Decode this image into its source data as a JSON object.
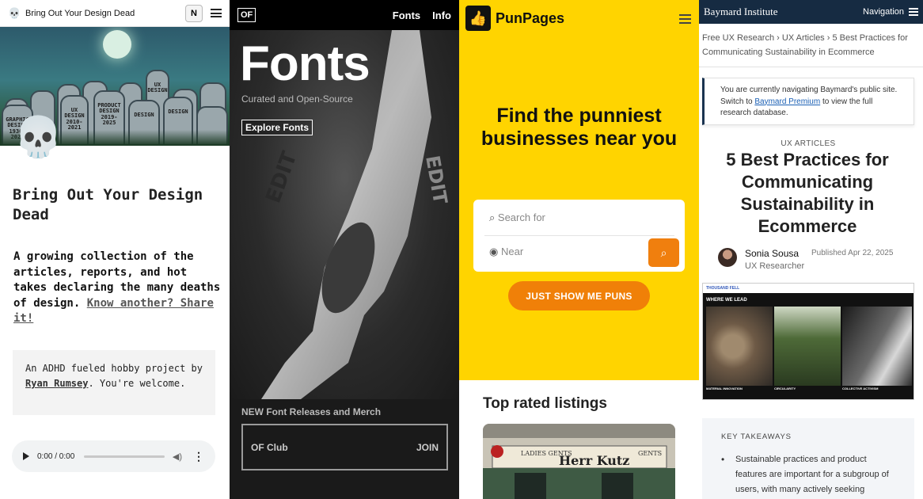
{
  "panel1": {
    "tab_title": "Bring Out Your Design Dead",
    "favicon": "💀",
    "notion_icon": "N",
    "hero_tombstones": [
      "UX DESIGN",
      "GRAPHIC DESIGN 1930-2021",
      "UX DESIGN 2010-2021",
      "PRODUCT DESIGN 2019-2025",
      "DESIGN",
      "DESIGN"
    ],
    "skull": "💀",
    "heading": "Bring Out Your Design Dead",
    "lede": "A growing collection of the articles, reports, and hot takes declaring the many deaths of design.",
    "lede_link": "Know another? Share it!",
    "note_prefix": "An ADHD fueled hobby project by ",
    "note_author": "Ryan Rumsey",
    "note_suffix": ". You're welcome.",
    "audio_time": "0:00 / 0:00"
  },
  "panel2": {
    "logo": "OF",
    "nav": [
      "Fonts",
      "Info"
    ],
    "hero_title": "Fonts",
    "hero_subtitle": "Curated and Open-Source",
    "hero_button": "Explore Fonts",
    "hero_edit_text": [
      "EDIT",
      "EDIT"
    ],
    "release_label": "NEW Font Releases and Merch",
    "club_label": "OF Club",
    "club_join": "JOIN"
  },
  "panel3": {
    "brand": "PunPages",
    "headline": "Find the punniest businesses near you",
    "search_placeholder": "Search for",
    "near_placeholder": "Near",
    "cta": "JUST SHOW ME PUNS",
    "section_title": "Top rated listings",
    "listing_sign_left": "LADIES GENTS",
    "listing_sign": "Herr Kutz",
    "listing_sign_right": "GENTS"
  },
  "panel4": {
    "brand": "Baymard Institute",
    "nav_label": "Navigation",
    "breadcrumbs": [
      "Free UX Research",
      "UX Articles",
      "5 Best Practices for Communicating Sustainability in Ecommerce"
    ],
    "notice_prefix": "You are currently navigating Baymard's public site. Switch to ",
    "notice_link": "Baymard Premium",
    "notice_suffix": " to view the full research database.",
    "kicker": "UX ARTICLES",
    "title": "5 Best Practices for Communicating Sustainability in Ecommerce",
    "author_name": "Sonia Sousa",
    "published": "Published Apr 22, 2025",
    "author_role": "UX Researcher",
    "screenshot_brand": "THOUSAND FELL",
    "screenshot_heading": "WHERE WE LEAD",
    "screenshot_captions": [
      "MATERIAL INNOVATION",
      "CIRCULARITY",
      "COLLECTIVE ACTIVISM"
    ],
    "takeaways_heading": "KEY TAKEAWAYS",
    "takeaway_1": "Sustainable practices and product features are important for a subgroup of users, with many actively seeking"
  }
}
